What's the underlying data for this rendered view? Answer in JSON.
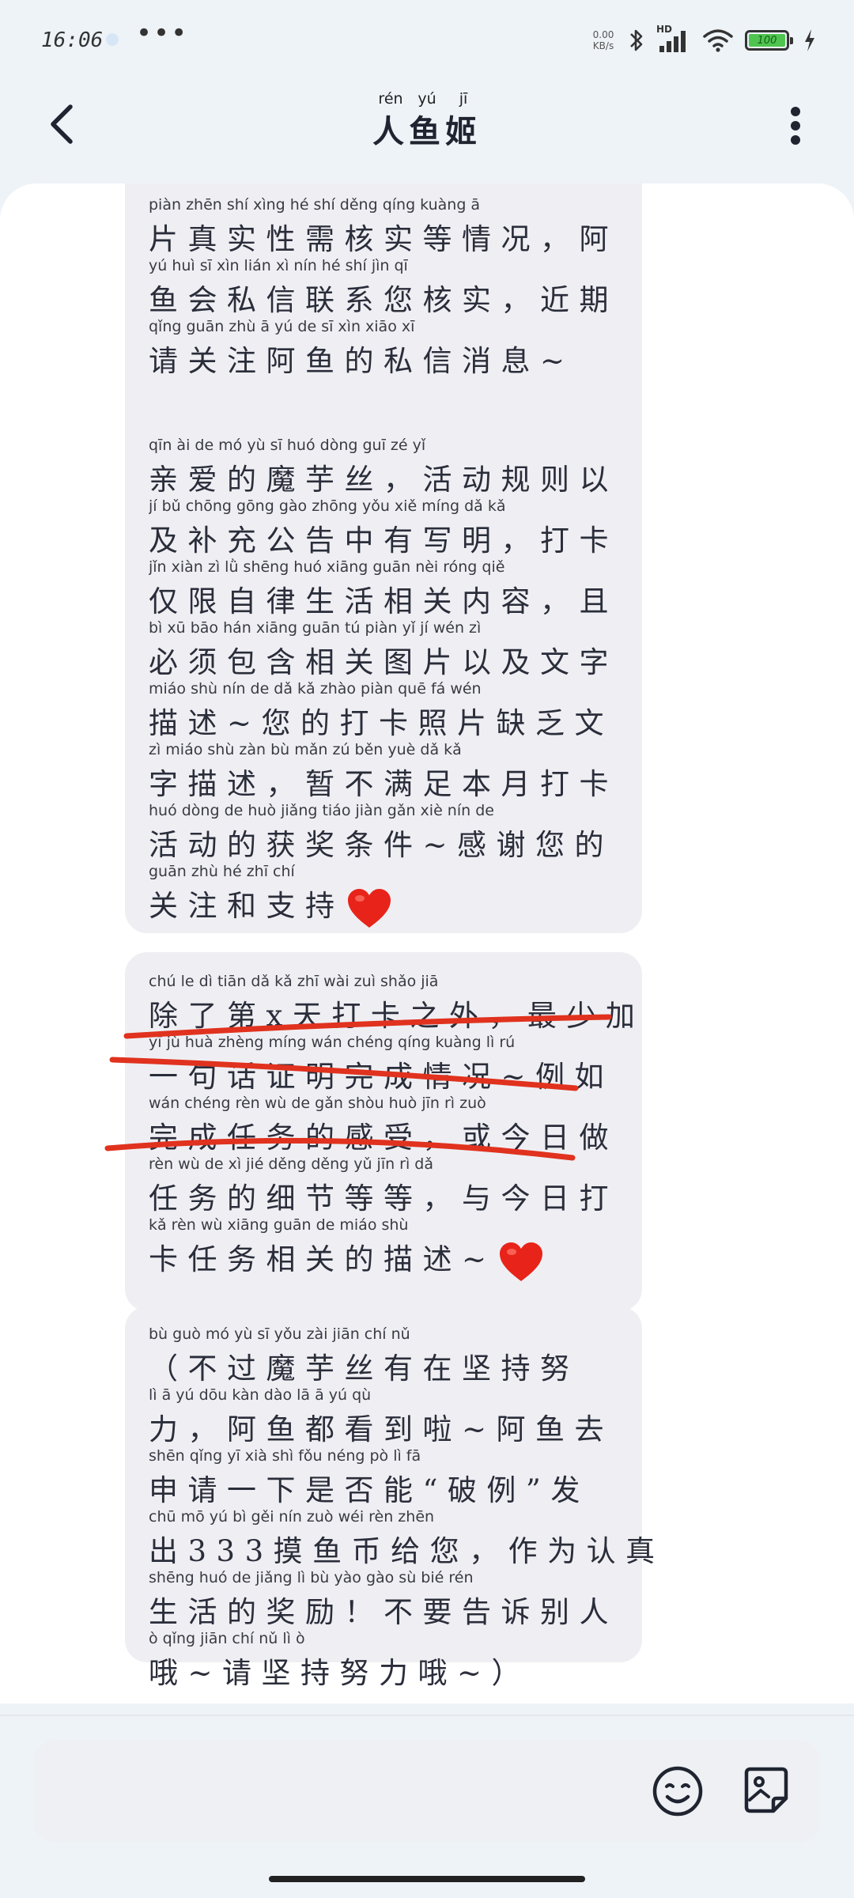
{
  "status_bar": {
    "time": "16:06",
    "more": "•••",
    "net_speed_value": "0.00",
    "net_speed_unit": "KB/s",
    "network": "HD",
    "battery_level": "100",
    "icons": [
      "bluetooth-icon",
      "signal-icon",
      "wifi-icon",
      "battery-icon",
      "charging-icon"
    ]
  },
  "header": {
    "title": "人鱼姬",
    "title_pinyin": [
      "rén",
      "yú",
      "jī"
    ],
    "back_icon": "chevron-left-icon",
    "menu_icon": "more-vertical-icon"
  },
  "messages": [
    {
      "lines": [
        {
          "py": "piàn zhēn shí xìng                hé shí děng qíng kuàng               ā",
          "hz": "片真实性需核实等情况，阿"
        },
        {
          "py": "yú  huì  sī  xìn  lián  xì  nín  hé  shí               jìn  qī",
          "hz": "鱼会私信联系您核实，近期"
        },
        {
          "py": "qǐng guān zhù  ā   yú  de  sī  xìn xiāo  xī",
          "hz": "请关注阿鱼的私信消息~"
        }
      ]
    },
    {
      "lines": [
        {
          "py": "qīn  ài   de  mó  yù  sī          huó dòng guī  zé   yǐ",
          "hz": "亲爱的魔芋丝，活动规则以"
        },
        {
          "py": " jí   bǔ chōng gōng gào zhōng yǒu  xiě míng          dǎ   kǎ",
          "hz": "及补充公告中有写明，打卡"
        },
        {
          "py": "jǐn xiàn  zì   lǜ shēng huó xiāng guān nèi róng          qiě",
          "hz": "仅限自律生活相关内容，且"
        },
        {
          "py": " bì  xū  bāo  hán xiāng guān  tú  piàn  yǐ   jí  wén  zì",
          "hz": "必须包含相关图片以及文字"
        },
        {
          "py": "miáo shù     nín  de   dǎ  kǎ zhào piàn quē  fá  wén",
          "hz": "描述~您的打卡照片缺乏文"
        },
        {
          "py": " zì miáo shù         zàn  bù  mǎn  zú  běn  yuè  dǎ   kǎ",
          "hz": "字描述，暂不满足本月打卡"
        },
        {
          "py": "huó dòng de  huò jiǎng tiáo jiàn    gǎn  xiè  nín  de",
          "hz": "活动的获奖条件~感谢您的"
        },
        {
          "py": "guān zhù  hé  zhī  chí",
          "hz": "关注和支持",
          "heart": true
        }
      ]
    },
    {
      "lines": [
        {
          "py": "chú  le   dì     tiān  dǎ  kǎ  zhī wài        zuì shǎo jiā",
          "hz": "除了第x天打卡之外，最少加"
        },
        {
          "py": " yī   jù  huà zhèng míng wán chéng qíng kuàng     lì   rú",
          "hz": "一句话证明完成情况~例如"
        },
        {
          "py": "wán chéng rèn  wù  de  gǎn shòu         huò  jīn   rì  zuò",
          "hz": "完成任务的感受，或今日做"
        },
        {
          "py": "rèn  wù  de   xì   jié děng děng         yǔ  jīn  rì   dǎ",
          "hz": "任务的细节等等，与今日打"
        },
        {
          "py": " kǎ  rèn  wù xiāng guān de miáo shù",
          "hz": "卡任务相关的描述~",
          "heart": true
        }
      ]
    },
    {
      "lines": [
        {
          "py": "      bù  guò  mó   yù  sī  yǒu  zài  jiān chí  nǔ",
          "hz": "（不过魔芋丝有在坚持努"
        },
        {
          "py": " lì        ā   yú  dōu kàn dào  lā     ā   yú  qù",
          "hz": "力，阿鱼都看到啦~阿鱼去"
        },
        {
          "py": "shēn qǐng  yī  xià  shì  fǒu néng        pò   lì          fā",
          "hz": "申请一下是否能“破例”发"
        },
        {
          "py": "chū          mō  yú   bì  gěi  nín        zuò wéi rèn zhēn",
          "hz": "出333摸鱼币给您，作为认真"
        },
        {
          "py": "shēng huó de jiǎng  lì        bù  yào gào  sù  bié  rén",
          "hz": "生活的奖励！不要告诉别人"
        },
        {
          "py": " ò    qǐng jiān chí  nǔ   lì   ò",
          "hz": "哦~请坚持努力哦~）"
        }
      ]
    }
  ],
  "input": {
    "placeholder": "",
    "emoji_icon": "smiley-face-icon",
    "sticker_icon": "sticker-image-icon"
  },
  "annotation_color": "#e0321e",
  "heart_color": "#e8241a"
}
